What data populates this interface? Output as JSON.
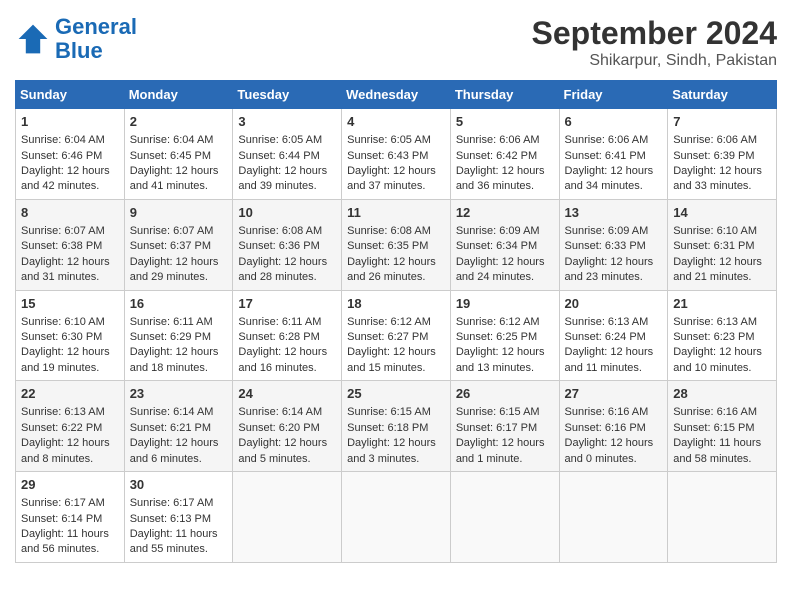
{
  "header": {
    "logo_line1": "General",
    "logo_line2": "Blue",
    "month_year": "September 2024",
    "location": "Shikarpur, Sindh, Pakistan"
  },
  "days_of_week": [
    "Sunday",
    "Monday",
    "Tuesday",
    "Wednesday",
    "Thursday",
    "Friday",
    "Saturday"
  ],
  "weeks": [
    [
      {
        "day": 1,
        "lines": [
          "Sunrise: 6:04 AM",
          "Sunset: 6:46 PM",
          "Daylight: 12 hours",
          "and 42 minutes."
        ]
      },
      {
        "day": 2,
        "lines": [
          "Sunrise: 6:04 AM",
          "Sunset: 6:45 PM",
          "Daylight: 12 hours",
          "and 41 minutes."
        ]
      },
      {
        "day": 3,
        "lines": [
          "Sunrise: 6:05 AM",
          "Sunset: 6:44 PM",
          "Daylight: 12 hours",
          "and 39 minutes."
        ]
      },
      {
        "day": 4,
        "lines": [
          "Sunrise: 6:05 AM",
          "Sunset: 6:43 PM",
          "Daylight: 12 hours",
          "and 37 minutes."
        ]
      },
      {
        "day": 5,
        "lines": [
          "Sunrise: 6:06 AM",
          "Sunset: 6:42 PM",
          "Daylight: 12 hours",
          "and 36 minutes."
        ]
      },
      {
        "day": 6,
        "lines": [
          "Sunrise: 6:06 AM",
          "Sunset: 6:41 PM",
          "Daylight: 12 hours",
          "and 34 minutes."
        ]
      },
      {
        "day": 7,
        "lines": [
          "Sunrise: 6:06 AM",
          "Sunset: 6:39 PM",
          "Daylight: 12 hours",
          "and 33 minutes."
        ]
      }
    ],
    [
      {
        "day": 8,
        "lines": [
          "Sunrise: 6:07 AM",
          "Sunset: 6:38 PM",
          "Daylight: 12 hours",
          "and 31 minutes."
        ]
      },
      {
        "day": 9,
        "lines": [
          "Sunrise: 6:07 AM",
          "Sunset: 6:37 PM",
          "Daylight: 12 hours",
          "and 29 minutes."
        ]
      },
      {
        "day": 10,
        "lines": [
          "Sunrise: 6:08 AM",
          "Sunset: 6:36 PM",
          "Daylight: 12 hours",
          "and 28 minutes."
        ]
      },
      {
        "day": 11,
        "lines": [
          "Sunrise: 6:08 AM",
          "Sunset: 6:35 PM",
          "Daylight: 12 hours",
          "and 26 minutes."
        ]
      },
      {
        "day": 12,
        "lines": [
          "Sunrise: 6:09 AM",
          "Sunset: 6:34 PM",
          "Daylight: 12 hours",
          "and 24 minutes."
        ]
      },
      {
        "day": 13,
        "lines": [
          "Sunrise: 6:09 AM",
          "Sunset: 6:33 PM",
          "Daylight: 12 hours",
          "and 23 minutes."
        ]
      },
      {
        "day": 14,
        "lines": [
          "Sunrise: 6:10 AM",
          "Sunset: 6:31 PM",
          "Daylight: 12 hours",
          "and 21 minutes."
        ]
      }
    ],
    [
      {
        "day": 15,
        "lines": [
          "Sunrise: 6:10 AM",
          "Sunset: 6:30 PM",
          "Daylight: 12 hours",
          "and 19 minutes."
        ]
      },
      {
        "day": 16,
        "lines": [
          "Sunrise: 6:11 AM",
          "Sunset: 6:29 PM",
          "Daylight: 12 hours",
          "and 18 minutes."
        ]
      },
      {
        "day": 17,
        "lines": [
          "Sunrise: 6:11 AM",
          "Sunset: 6:28 PM",
          "Daylight: 12 hours",
          "and 16 minutes."
        ]
      },
      {
        "day": 18,
        "lines": [
          "Sunrise: 6:12 AM",
          "Sunset: 6:27 PM",
          "Daylight: 12 hours",
          "and 15 minutes."
        ]
      },
      {
        "day": 19,
        "lines": [
          "Sunrise: 6:12 AM",
          "Sunset: 6:25 PM",
          "Daylight: 12 hours",
          "and 13 minutes."
        ]
      },
      {
        "day": 20,
        "lines": [
          "Sunrise: 6:13 AM",
          "Sunset: 6:24 PM",
          "Daylight: 12 hours",
          "and 11 minutes."
        ]
      },
      {
        "day": 21,
        "lines": [
          "Sunrise: 6:13 AM",
          "Sunset: 6:23 PM",
          "Daylight: 12 hours",
          "and 10 minutes."
        ]
      }
    ],
    [
      {
        "day": 22,
        "lines": [
          "Sunrise: 6:13 AM",
          "Sunset: 6:22 PM",
          "Daylight: 12 hours",
          "and 8 minutes."
        ]
      },
      {
        "day": 23,
        "lines": [
          "Sunrise: 6:14 AM",
          "Sunset: 6:21 PM",
          "Daylight: 12 hours",
          "and 6 minutes."
        ]
      },
      {
        "day": 24,
        "lines": [
          "Sunrise: 6:14 AM",
          "Sunset: 6:20 PM",
          "Daylight: 12 hours",
          "and 5 minutes."
        ]
      },
      {
        "day": 25,
        "lines": [
          "Sunrise: 6:15 AM",
          "Sunset: 6:18 PM",
          "Daylight: 12 hours",
          "and 3 minutes."
        ]
      },
      {
        "day": 26,
        "lines": [
          "Sunrise: 6:15 AM",
          "Sunset: 6:17 PM",
          "Daylight: 12 hours",
          "and 1 minute."
        ]
      },
      {
        "day": 27,
        "lines": [
          "Sunrise: 6:16 AM",
          "Sunset: 6:16 PM",
          "Daylight: 12 hours",
          "and 0 minutes."
        ]
      },
      {
        "day": 28,
        "lines": [
          "Sunrise: 6:16 AM",
          "Sunset: 6:15 PM",
          "Daylight: 11 hours",
          "and 58 minutes."
        ]
      }
    ],
    [
      {
        "day": 29,
        "lines": [
          "Sunrise: 6:17 AM",
          "Sunset: 6:14 PM",
          "Daylight: 11 hours",
          "and 56 minutes."
        ]
      },
      {
        "day": 30,
        "lines": [
          "Sunrise: 6:17 AM",
          "Sunset: 6:13 PM",
          "Daylight: 11 hours",
          "and 55 minutes."
        ]
      },
      null,
      null,
      null,
      null,
      null
    ]
  ]
}
